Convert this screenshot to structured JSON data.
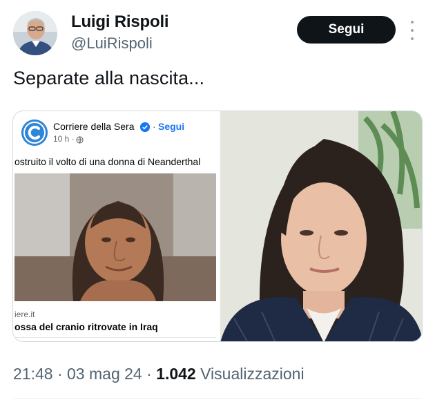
{
  "author": {
    "name": "Luigi Rispoli",
    "handle": "@LuiRispoli",
    "follow_label": "Segui"
  },
  "tweet": {
    "text": "Separate alla nascita...",
    "time": "21:48",
    "dot1": "·",
    "date": "03 mag 24",
    "dot2": "·",
    "views_count": "1.042",
    "views_label": "Visualizzazioni"
  },
  "embedded_post": {
    "source": "Corriere della Sera",
    "separator": "·",
    "follow_label": "Segui",
    "time": "10 h ·",
    "caption": "ostruito il volto di una donna di Neanderthal",
    "domain": "iere.it",
    "headline": "ossa del cranio ritrovate in Iraq"
  },
  "icons": {
    "more": "more-vertical-icon",
    "verified": "verified-badge-icon",
    "globe": "globe-icon",
    "logo": "corriere-c-logo-icon"
  },
  "colors": {
    "follow_button_bg": "#0f1419",
    "secondary_text": "#536471",
    "facebook_blue": "#1877f2",
    "corriere_blue": "#2f86d6"
  }
}
